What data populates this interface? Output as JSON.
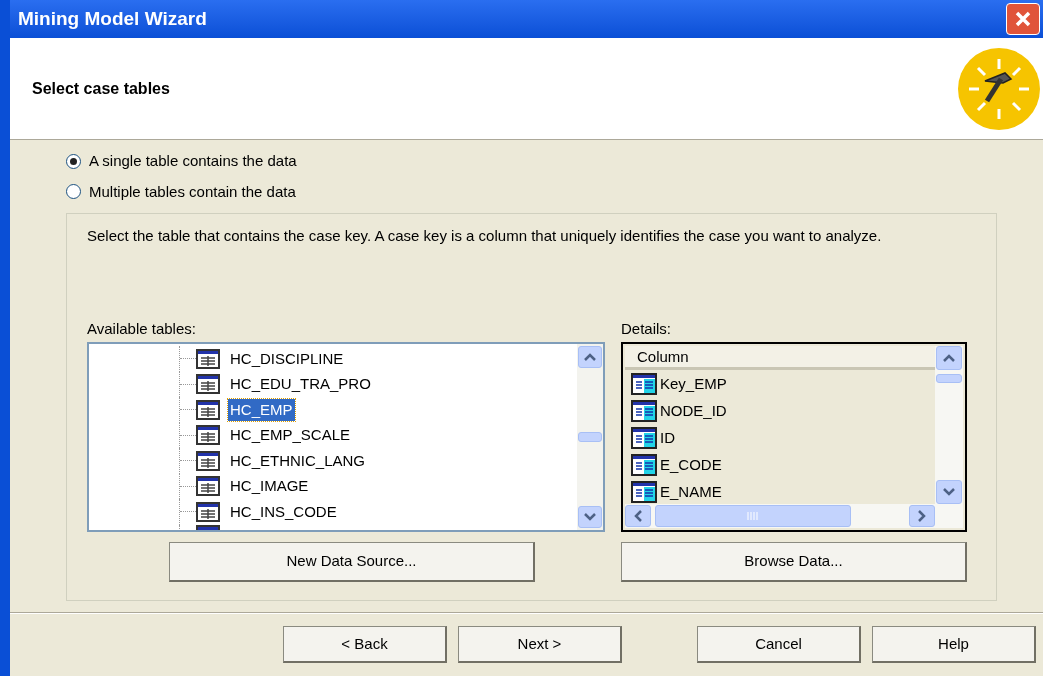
{
  "window": {
    "title": "Mining Model Wizard"
  },
  "header": {
    "title": "Select case tables"
  },
  "options": [
    {
      "label": "A single table contains the data",
      "selected": true
    },
    {
      "label": "Multiple tables contain the data",
      "selected": false
    }
  ],
  "description": "Select the table that contains the case key. A case key is a column that uniquely identifies the case you want to analyze.",
  "available_tables": {
    "label": "Available tables:",
    "items": [
      {
        "label": "HC_DISCIPLINE",
        "selected": false
      },
      {
        "label": "HC_EDU_TRA_PRO",
        "selected": false
      },
      {
        "label": "HC_EMP",
        "selected": true
      },
      {
        "label": "HC_EMP_SCALE",
        "selected": false
      },
      {
        "label": "HC_ETHNIC_LANG",
        "selected": false
      },
      {
        "label": "HC_IMAGE",
        "selected": false
      },
      {
        "label": "HC_INS_CODE",
        "selected": false
      }
    ],
    "button": "New Data Source..."
  },
  "details": {
    "label": "Details:",
    "column_header": "Column",
    "rows": [
      "Key_EMP",
      "NODE_ID",
      "ID",
      "E_CODE",
      "E_NAME"
    ],
    "button": "Browse Data..."
  },
  "buttons": [
    "< Back",
    "Next >",
    "Cancel",
    "Help"
  ]
}
